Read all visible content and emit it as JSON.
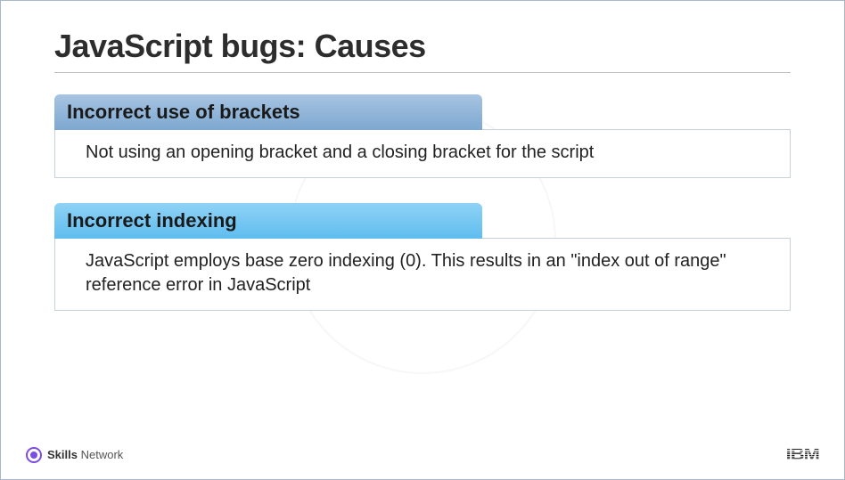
{
  "slide": {
    "title": "JavaScript bugs: Causes",
    "causes": [
      {
        "heading": "Incorrect use of brackets",
        "body": "Not using an opening bracket and a closing bracket for the script"
      },
      {
        "heading": "Incorrect indexing",
        "body": "JavaScript employs base zero indexing (0). This results in an \"index out of range\" reference error in JavaScript"
      }
    ]
  },
  "footer": {
    "skills_bold": "Skills",
    "skills_rest": "Network",
    "ibm": "IBM"
  }
}
